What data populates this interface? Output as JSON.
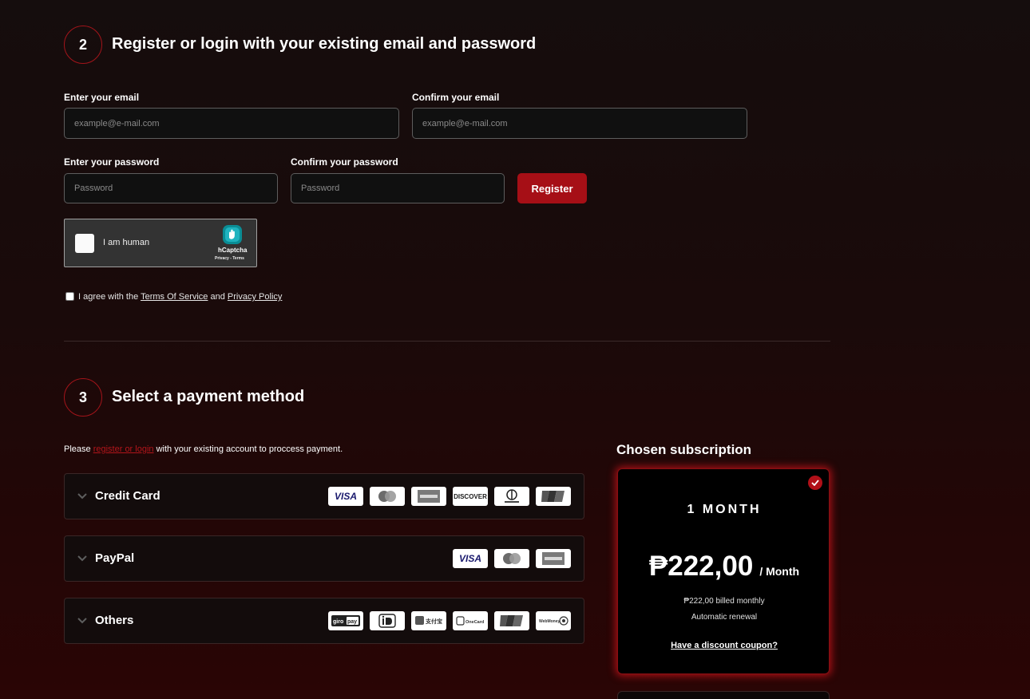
{
  "section2": {
    "step": "2",
    "title": "Register or login with your existing email and password",
    "email_label": "Enter your email",
    "email_placeholder": "example@e-mail.com",
    "confirm_email_label": "Confirm your email",
    "confirm_email_placeholder": "example@e-mail.com",
    "password_label": "Enter your password",
    "password_placeholder": "Password",
    "confirm_password_label": "Confirm your password",
    "confirm_password_placeholder": "Password",
    "register_button": "Register",
    "captcha": {
      "label": "I am human",
      "brand": "hCaptcha",
      "privacy": "Privacy",
      "separator": "-",
      "terms": "Terms"
    },
    "agree": {
      "prefix": "I agree with the",
      "terms_link": "Terms Of Service",
      "and": "and",
      "privacy_link": "Privacy Policy"
    }
  },
  "section3": {
    "step": "3",
    "title": "Select a payment method",
    "notice": {
      "prefix": "Please",
      "link": "register or login",
      "suffix": "with your existing account to proccess payment."
    },
    "methods": [
      {
        "label": "Credit Card",
        "logos": [
          "VISA",
          "Mastercard",
          "AMEX",
          "DISCOVER",
          "Diners Club",
          "UnionPay"
        ]
      },
      {
        "label": "PayPal",
        "logos": [
          "VISA",
          "Mastercard",
          "AMEX"
        ]
      },
      {
        "label": "Others",
        "logos": [
          "giropay",
          "iDEAL",
          "Alipay",
          "OneCard",
          "UnionPay",
          "WebMoney"
        ]
      }
    ]
  },
  "subscription": {
    "heading": "Chosen subscription",
    "plan": "1 MONTH",
    "price": "₱222,00",
    "period": "/ Month",
    "billed": "₱222,00 billed monthly",
    "renewal": "Automatic renewal",
    "coupon": "Have a discount coupon?"
  },
  "colors": {
    "accent_red": "#a60f16",
    "link_red": "#b3151b",
    "glow_red": "#dc141c"
  }
}
